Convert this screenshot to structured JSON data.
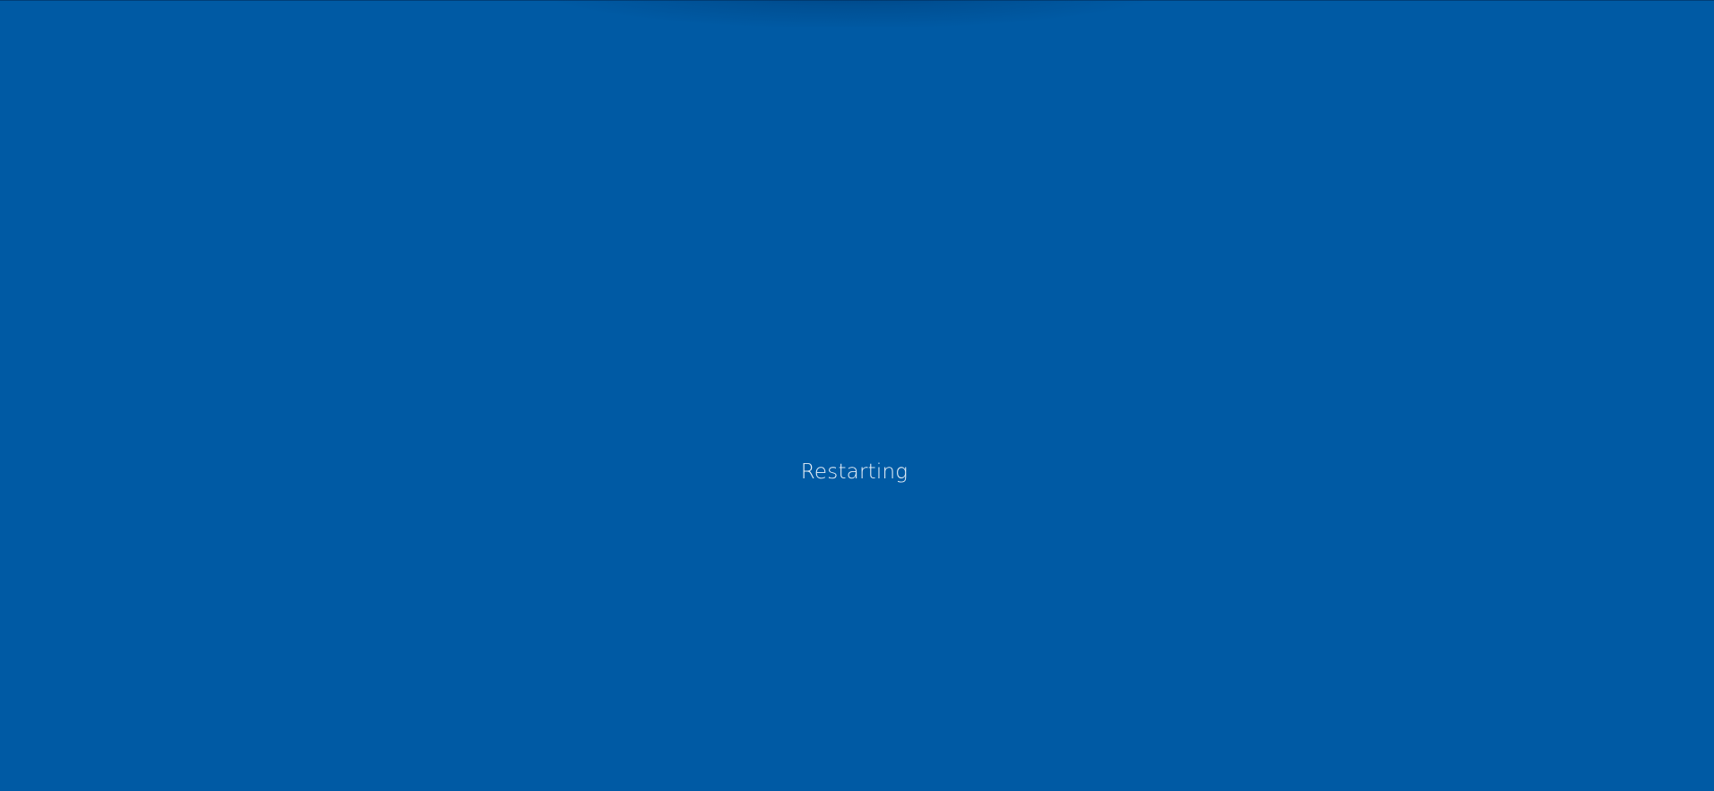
{
  "screen": {
    "status_text": "Restarting",
    "background_color": "#005aa4",
    "text_color": "#e8f0f8"
  }
}
